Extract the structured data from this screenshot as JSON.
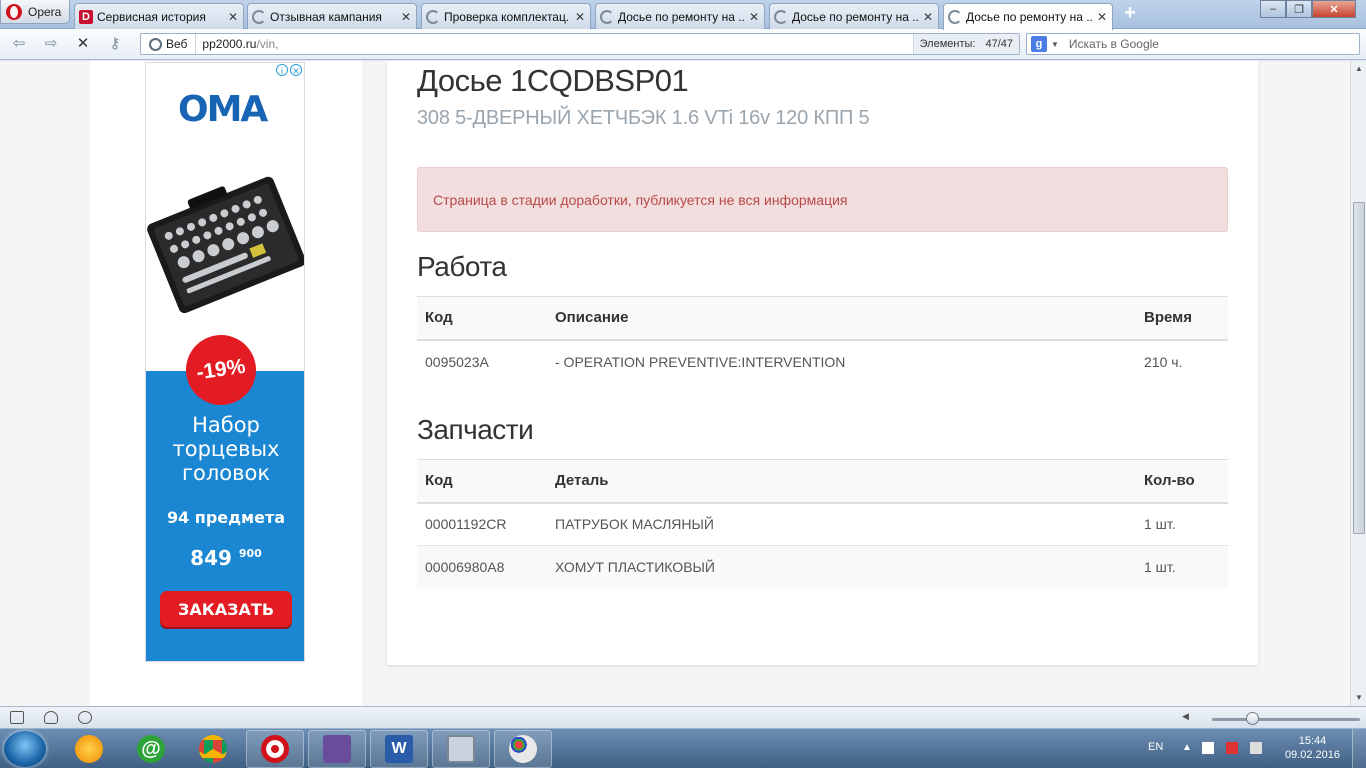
{
  "browser": {
    "menu_label": "Opera",
    "tabs": [
      {
        "title": "Сервисная история",
        "favicon": "d-favicon"
      },
      {
        "title": "Отзывная кампания",
        "favicon": "loading-spinner"
      },
      {
        "title": "Проверка комплектац...",
        "favicon": "loading-spinner"
      },
      {
        "title": "Досье по ремонту на ...",
        "favicon": "loading-spinner"
      },
      {
        "title": "Досье по ремонту на ...",
        "favicon": "loading-spinner"
      },
      {
        "title": "Досье по ремонту на ...",
        "favicon": "loading-spinner",
        "active": true
      }
    ],
    "address": {
      "scope_label": "Веб",
      "url_host": "pp2000.ru",
      "url_path": "/vin,",
      "elements_label": "Элементы:",
      "elements_count": "47/47"
    },
    "search": {
      "placeholder": "Искать в Google",
      "engine": "google-g-icon"
    }
  },
  "page": {
    "title": "Досье 1CQDBSP01",
    "subtitle": "308 5-ДВЕРНЫЙ ХЕТЧБЭК 1.6 VTi 16v 120 КПП 5",
    "alert": "Страница в стадии доработки, публикуется не вся информация",
    "work": {
      "heading": "Работа",
      "columns": [
        "Код",
        "Описание",
        "Время"
      ],
      "rows": [
        [
          "0095023A",
          "- OPERATION PREVENTIVE:INTERVENTION",
          "210 ч."
        ]
      ]
    },
    "parts": {
      "heading": "Запчасти",
      "columns": [
        "Код",
        "Деталь",
        "Кол-во"
      ],
      "rows": [
        [
          "00001192CR",
          "ПАТРУБОК МАСЛЯНЫЙ",
          "1 шт."
        ],
        [
          "00006980A8",
          "ХОМУТ ПЛАСТИКОВЫЙ",
          "1 шт."
        ]
      ]
    }
  },
  "ad": {
    "brand": "OMA",
    "discount": "-19%",
    "headline": "Набор торцевых головок",
    "items": "94 предмета",
    "price": "849",
    "price_cents": "900",
    "cta": "ЗАКАЗАТЬ"
  },
  "taskbar": {
    "lang": "EN",
    "time": "15:44",
    "date": "09.02.2016",
    "apps": [
      "start-orb",
      "odnoklassniki-icon",
      "mail-agent-icon",
      "chrome-icon",
      "opera-icon",
      "floppy-save-icon",
      "word-icon",
      "calculator-icon",
      "paint-icon"
    ]
  },
  "colors": {
    "alert_bg": "#f2dede",
    "alert_text": "#b94a48",
    "ad_blue": "#1b87d2",
    "ad_red": "#e31b23",
    "subtitle": "#9aa5ae"
  }
}
